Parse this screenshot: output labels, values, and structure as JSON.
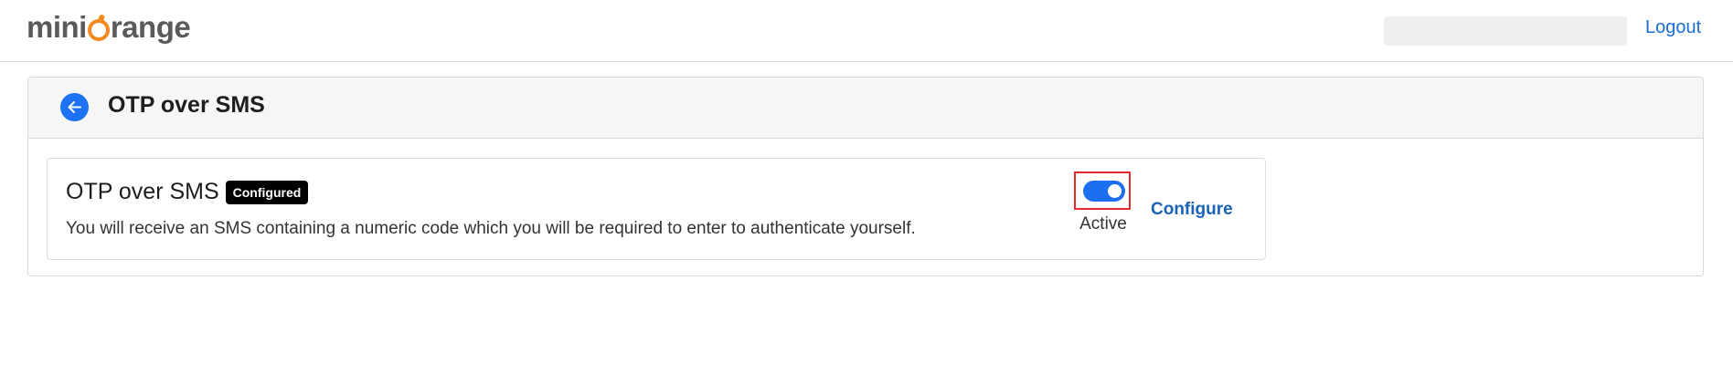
{
  "header": {
    "logo": {
      "prefix": "mini",
      "suffix": "range"
    },
    "logout_label": "Logout"
  },
  "page": {
    "title": "OTP over SMS"
  },
  "method": {
    "title": "OTP over SMS",
    "badge": "Configured",
    "description": "You will receive an SMS containing a numeric code which you will be required to enter to authenticate yourself.",
    "toggle_state": "on",
    "toggle_label": "Active",
    "configure_label": "Configure"
  },
  "colors": {
    "accent": "#1d6ff2",
    "link": "#1a63b8",
    "logo_orange": "#f28b20",
    "highlight_border": "#e32b2b",
    "badge_bg": "#000000"
  },
  "icons": {
    "back": "arrow-left-icon",
    "toggle": "toggle-switch-icon"
  }
}
